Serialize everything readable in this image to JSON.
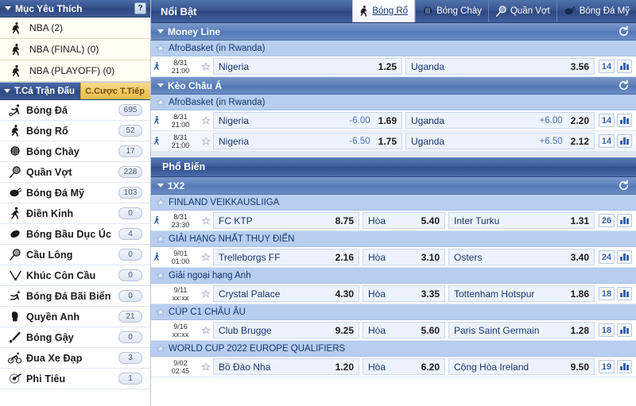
{
  "sidebar": {
    "favorites": {
      "title": "Mục Yêu Thích",
      "help_label": "?",
      "items": [
        {
          "icon": "basketball-icon",
          "label": "NBA (2)"
        },
        {
          "icon": "basketball-icon",
          "label": "NBA (FINAL) (0)"
        },
        {
          "icon": "basketball-icon",
          "label": "NBA (PLAYOFF) (0)"
        }
      ]
    },
    "tabs": [
      {
        "label": "T.Cả Trận Đấu",
        "active": true
      },
      {
        "label": "C.Cược T.Tiếp",
        "active": false
      }
    ],
    "sports": [
      {
        "icon": "soccer-icon",
        "label": "Bóng Đá",
        "count": "695"
      },
      {
        "icon": "basketball-icon",
        "label": "Bóng Rổ",
        "count": "52"
      },
      {
        "icon": "baseball-icon",
        "label": "Bóng Chày",
        "count": "17"
      },
      {
        "icon": "tennis-icon",
        "label": "Quần Vợt",
        "count": "228"
      },
      {
        "icon": "football-icon",
        "label": "Bóng Đá Mỹ",
        "count": "103"
      },
      {
        "icon": "athletics-icon",
        "label": "Điền Kinh",
        "count": "0"
      },
      {
        "icon": "afl-icon",
        "label": "Bóng Bầu Dục Úc",
        "count": "4"
      },
      {
        "icon": "badminton-icon",
        "label": "Cầu Lông",
        "count": "0"
      },
      {
        "icon": "hockey-icon",
        "label": "Khúc Côn Cầu",
        "count": "0"
      },
      {
        "icon": "beachsoccer-icon",
        "label": "Bóng Đá Bãi Biển",
        "count": "0"
      },
      {
        "icon": "boxing-icon",
        "label": "Quyền Anh",
        "count": "21"
      },
      {
        "icon": "cricket-icon",
        "label": "Bóng Gậy",
        "count": "0"
      },
      {
        "icon": "cycling-icon",
        "label": "Đua Xe Đạp",
        "count": "3"
      },
      {
        "icon": "darts-icon",
        "label": "Phi Tiêu",
        "count": "1"
      }
    ]
  },
  "main": {
    "title": "Nổi Bật",
    "tabs": [
      {
        "icon": "basketball-icon",
        "label": "Bóng Rổ",
        "active": true
      },
      {
        "icon": "baseball-icon",
        "label": "Bóng Chày",
        "active": false
      },
      {
        "icon": "tennis-icon",
        "label": "Quần Vợt",
        "active": false
      },
      {
        "icon": "football-icon",
        "label": "Bóng Đá Mỹ",
        "active": false
      }
    ],
    "sections": [
      {
        "kind": "market",
        "title": "Money Line",
        "refresh_icon": "refresh-icon",
        "groups": [
          {
            "league": "AfroBasket (in Rwanda)",
            "events": [
              {
                "live_icon": "live-icon",
                "date": "8/31",
                "time": "21:00",
                "star_icon": "star-icon",
                "home": "Nigeria",
                "home_hdp": "",
                "home_price": "1.25",
                "draw": null,
                "draw_price": null,
                "away": "Uganda",
                "away_hdp": "",
                "away_price": "3.56",
                "count": "14",
                "chart_icon": "bar-chart-icon"
              }
            ]
          }
        ]
      },
      {
        "kind": "market",
        "title": "Kèo Châu Á",
        "refresh_icon": "refresh-icon",
        "groups": [
          {
            "league": "AfroBasket (in Rwanda)",
            "events": [
              {
                "live_icon": "live-icon",
                "date": "8/31",
                "time": "21:00",
                "star_icon": "star-icon",
                "home": "Nigeria",
                "home_hdp": "-6.00",
                "home_price": "1.69",
                "draw": null,
                "draw_price": null,
                "away": "Uganda",
                "away_hdp": "+6.00",
                "away_price": "2.20",
                "count": "14",
                "chart_icon": "bar-chart-icon"
              },
              {
                "live_icon": "live-icon",
                "date": "8/31",
                "time": "21:00",
                "star_icon": "star-icon",
                "home": "Nigeria",
                "home_hdp": "-6.50",
                "home_price": "1.75",
                "draw": null,
                "draw_price": null,
                "away": "Uganda",
                "away_hdp": "+6.50",
                "away_price": "2.12",
                "count": "14",
                "chart_icon": "bar-chart-icon"
              }
            ]
          }
        ]
      },
      {
        "kind": "banner",
        "title": "Phổ Biến"
      },
      {
        "kind": "market",
        "title": "1X2",
        "refresh_icon": "refresh-icon",
        "groups": [
          {
            "league": "FINLAND VEIKKAUSLIIGA",
            "events": [
              {
                "live_icon": "live-icon",
                "date": "8/31",
                "time": "23:30",
                "star_icon": "star-icon",
                "home": "FC KTP",
                "home_hdp": "",
                "home_price": "8.75",
                "draw": "Hòa",
                "draw_price": "5.40",
                "away": "Inter Turku",
                "away_hdp": "",
                "away_price": "1.31",
                "count": "26",
                "chart_icon": "bar-chart-icon"
              }
            ]
          },
          {
            "league": "GIẢI HẠNG NHẤT THỤY ĐIỂN",
            "events": [
              {
                "live_icon": "live-icon",
                "date": "9/01",
                "time": "01:00",
                "star_icon": "star-icon",
                "home": "Trelleborgs FF",
                "home_hdp": "",
                "home_price": "2.16",
                "draw": "Hòa",
                "draw_price": "3.10",
                "away": "Osters",
                "away_hdp": "",
                "away_price": "3.40",
                "count": "24",
                "chart_icon": "bar-chart-icon"
              }
            ]
          },
          {
            "league": "Giải ngoại hạng Anh",
            "events": [
              {
                "live_icon": "",
                "date": "9/11",
                "time": "xx:xx",
                "star_icon": "star-icon",
                "home": "Crystal Palace",
                "home_hdp": "",
                "home_price": "4.30",
                "draw": "Hòa",
                "draw_price": "3.35",
                "away": "Tottenham Hotspur",
                "away_hdp": "",
                "away_price": "1.86",
                "count": "18",
                "chart_icon": "bar-chart-icon"
              }
            ]
          },
          {
            "league": "CÚP C1 CHÂU ÂU",
            "events": [
              {
                "live_icon": "",
                "date": "9/16",
                "time": "xx:xx",
                "star_icon": "star-icon",
                "home": "Club Brugge",
                "home_hdp": "",
                "home_price": "9.25",
                "draw": "Hòa",
                "draw_price": "5.60",
                "away": "Paris Saint Germain",
                "away_hdp": "",
                "away_price": "1.28",
                "count": "18",
                "chart_icon": "bar-chart-icon"
              }
            ]
          },
          {
            "league": "WORLD CUP 2022 EUROPE QUALIFIERS",
            "events": [
              {
                "live_icon": "",
                "date": "9/02",
                "time": "02:45",
                "star_icon": "star-icon",
                "home": "Bồ Đào Nha",
                "home_hdp": "",
                "home_price": "1.20",
                "draw": "Hòa",
                "draw_price": "6.20",
                "away": "Cộng Hòa Ireland",
                "away_hdp": "",
                "away_price": "9.50",
                "count": "19",
                "chart_icon": "bar-chart-icon"
              }
            ]
          }
        ]
      }
    ]
  },
  "colors": {
    "header_blue": "#2e4880",
    "market_header_blue": "#5d7fba",
    "league_blue": "#b7cef0",
    "accent_gold": "#f0cb63",
    "odds_text": "#16346e",
    "handicap_blue": "#4a74b8"
  }
}
